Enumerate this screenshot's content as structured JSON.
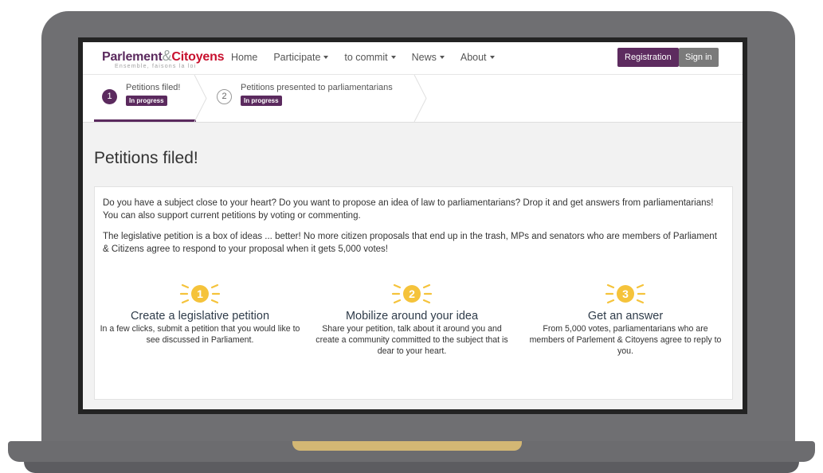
{
  "brand": {
    "title_part1": "Parlement",
    "title_amp": "&",
    "title_part2": "Citoyens",
    "tagline": "Ensemble, faisons la loi"
  },
  "nav": {
    "items": [
      {
        "label": "Home",
        "dropdown": false
      },
      {
        "label": "Participate",
        "dropdown": true
      },
      {
        "label": "to commit",
        "dropdown": true
      },
      {
        "label": "News",
        "dropdown": true
      },
      {
        "label": "About",
        "dropdown": true
      }
    ],
    "registration": "Registration",
    "sign_in": "Sign in"
  },
  "steps": [
    {
      "number": "1",
      "label": "Petitions filed!",
      "status": "In progress",
      "active": true
    },
    {
      "number": "2",
      "label": "Petitions presented to parliamentarians",
      "status": "In progress",
      "active": false
    }
  ],
  "content": {
    "title": "Petitions filed!",
    "paragraph1": "Do you have a subject close to your heart? Do you want to propose an idea of law to parliamentarians? Drop it and get answers from parliamentarians! You can also support current petitions by voting or commenting.",
    "paragraph2": "The legislative petition is a box of ideas ... better! No more citizen proposals that end up in the trash, MPs and senators who are members of Parliament & Citizens agree to respond to your proposal when it gets 5,000 votes!",
    "features": [
      {
        "number": "1",
        "title": "Create a legislative petition",
        "description": "In a few clicks, submit a petition that you would like to see discussed in Parliament."
      },
      {
        "number": "2",
        "title": "Mobilize around your idea",
        "description": "Share your petition, talk about it around you and create a community committed to the subject that is dear to your heart."
      },
      {
        "number": "3",
        "title": "Get an answer",
        "description": "From 5,000 votes, parliamentarians who are members of Parlement & Citoyens agree to reply to you."
      }
    ]
  },
  "colors": {
    "brand_purple": "#5b2a5e",
    "brand_red": "#c8102e",
    "icon_yellow": "#f5c33b",
    "laptop_gray": "#6f6f72",
    "laptop_gold": "#d3b774"
  }
}
